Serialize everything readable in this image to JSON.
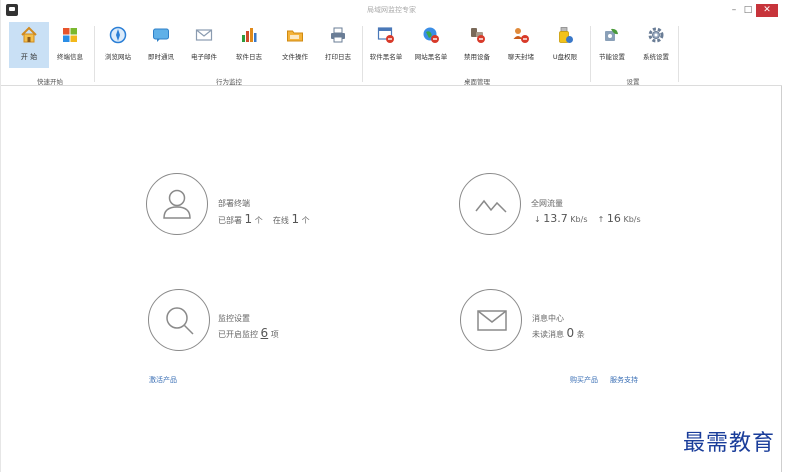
{
  "window": {
    "title": "局域网监控专家",
    "min_glyph": "–",
    "max_glyph": "□",
    "close_glyph": "✕"
  },
  "ribbon": {
    "tools": [
      {
        "id": "start",
        "label": "开 始",
        "icon": "home-icon",
        "color": "#e0a030"
      },
      {
        "id": "terminal-info",
        "label": "终端信息",
        "icon": "windows-flag-icon",
        "color": "#3a8ee6"
      },
      {
        "id": "browse-sites",
        "label": "浏览网站",
        "icon": "compass-icon",
        "color": "#2b7fd6"
      },
      {
        "id": "instant-msg",
        "label": "即时通讯",
        "icon": "chat-icon",
        "color": "#3f9bdc"
      },
      {
        "id": "email",
        "label": "电子邮件",
        "icon": "envelope-icon",
        "color": "#9aa9bb"
      },
      {
        "id": "software-log",
        "label": "软件日志",
        "icon": "bar-chart-icon",
        "color": "#d04a2a"
      },
      {
        "id": "file-ops",
        "label": "文件操作",
        "icon": "folder-icon",
        "color": "#f0a020"
      },
      {
        "id": "print-log",
        "label": "打印日志",
        "icon": "printer-icon",
        "color": "#6a7d96"
      },
      {
        "id": "software-blacklist",
        "label": "软件黑名单",
        "icon": "window-block-icon",
        "color": "#4a78b8"
      },
      {
        "id": "site-blacklist",
        "label": "网站黑名单",
        "icon": "globe-block-icon",
        "color": "#2f8a3c"
      },
      {
        "id": "disable-device",
        "label": "禁用设备",
        "icon": "device-block-icon",
        "color": "#7a6a5a"
      },
      {
        "id": "chat-block",
        "label": "聊天封堵",
        "icon": "people-block-icon",
        "color": "#c85a1a"
      },
      {
        "id": "usb-perm",
        "label": "U盘权限",
        "icon": "usb-icon",
        "color": "#d8a000"
      },
      {
        "id": "energy",
        "label": "节能设置",
        "icon": "energy-icon",
        "color": "#4a7a3a"
      },
      {
        "id": "sys-settings",
        "label": "系统设置",
        "icon": "gear-icon",
        "color": "#6a7d96"
      }
    ],
    "groups": {
      "quick_start": "快速开始",
      "behavior": "行为监控",
      "desktop": "桌面管理",
      "settings": "设置"
    }
  },
  "dashboard": {
    "deploy": {
      "title": "部署终端",
      "deployed_label": "已部署",
      "deployed_count": "1",
      "deployed_unit": "个",
      "online_label": "在线",
      "online_count": "1",
      "online_unit": "个"
    },
    "traffic": {
      "title": "全网流量",
      "down_arrow": "↓",
      "down_value": "13.7",
      "down_unit": "Kb/s",
      "up_arrow": "↑",
      "up_value": "16",
      "up_unit": "Kb/s"
    },
    "monitor": {
      "title": "监控设置",
      "enabled_label": "已开启监控",
      "enabled_count": "6",
      "enabled_unit": "项"
    },
    "messages": {
      "title": "消息中心",
      "unread_label": "未读消息",
      "unread_count": "0",
      "unread_unit": "条"
    }
  },
  "links": {
    "activate": "激活产品",
    "buy": "购买产品",
    "support": "服务支持"
  },
  "watermark": "最需教育"
}
